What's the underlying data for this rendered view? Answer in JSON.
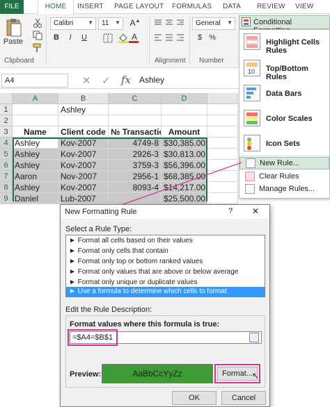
{
  "tabs": [
    "FILE",
    "HOME",
    "INSERT",
    "PAGE LAYOUT",
    "FORMULAS",
    "DATA",
    "REVIEW",
    "VIEW"
  ],
  "ribbon": {
    "font_name": "Calibri",
    "font_size": "11",
    "number_format": "General",
    "paste_label": "Paste",
    "groups": {
      "clipboard": "Clipboard",
      "alignment": "Alignment",
      "number": "Number"
    },
    "bold": "B",
    "italic": "I",
    "underline": "U",
    "font_a": "A",
    "currency": "$",
    "percent": "%"
  },
  "formula_bar": {
    "name_box": "A4",
    "fx": "fx",
    "value": "Ashley"
  },
  "grid": {
    "columns": [
      "A",
      "B",
      "C",
      "D"
    ],
    "rows": [
      "1",
      "2",
      "3",
      "4",
      "5",
      "6",
      "7",
      "8",
      "9"
    ],
    "cells": [
      [
        "",
        "Ashley",
        "",
        ""
      ],
      [
        "",
        "",
        "",
        ""
      ],
      [
        "Name",
        "Client code",
        "№ Transaction",
        "Amount"
      ],
      [
        "Ashley",
        "Kov-2007",
        "4749-8",
        "$30,385.00"
      ],
      [
        "Ashley",
        "Kov-2007",
        "2926-3",
        "$30,813.00"
      ],
      [
        "Ashley",
        "Kov-2007",
        "3759-3",
        "$56,396.00"
      ],
      [
        "Aaron",
        "Nov-2007",
        "2956-1",
        "$68,385.00"
      ],
      [
        "Ashley",
        "Kov-2007",
        "8093-4",
        "$14,217.00"
      ],
      [
        "Daniel",
        "Lub-2007",
        "",
        "$25,500.00"
      ]
    ]
  },
  "cf_menu": {
    "button": "Conditional Formatting",
    "items": [
      "Highlight Cells Rules",
      "Top/Bottom Rules",
      "Data Bars",
      "Color Scales",
      "Icon Sets"
    ],
    "small_items": [
      "New Rule...",
      "Clear Rules",
      "Manage Rules..."
    ]
  },
  "dialog": {
    "title": "New Formatting Rule",
    "close": "?",
    "select_label": "Select a Rule Type:",
    "rules": [
      "► Format all cells based on their values",
      "► Format only cells that contain",
      "► Format only top or bottom ranked values",
      "► Format only values that are above or below average",
      "► Format only unique or duplicate values",
      "► Use a formula to determine which cells to format"
    ],
    "edit_label": "Edit the Rule Description:",
    "formula_label": "Format values where this formula is true:",
    "formula_value": "=$A4=$B$1",
    "preview_label": "Preview:",
    "preview_text": "AaBbCcYyZz",
    "format_button": "Format...",
    "ok": "OK",
    "cancel": "Cancel"
  },
  "colors": {
    "excel_green": "#217346",
    "highlight": "#d6338c",
    "preview_fill": "#3d9b35",
    "selection": "#3399ff"
  }
}
